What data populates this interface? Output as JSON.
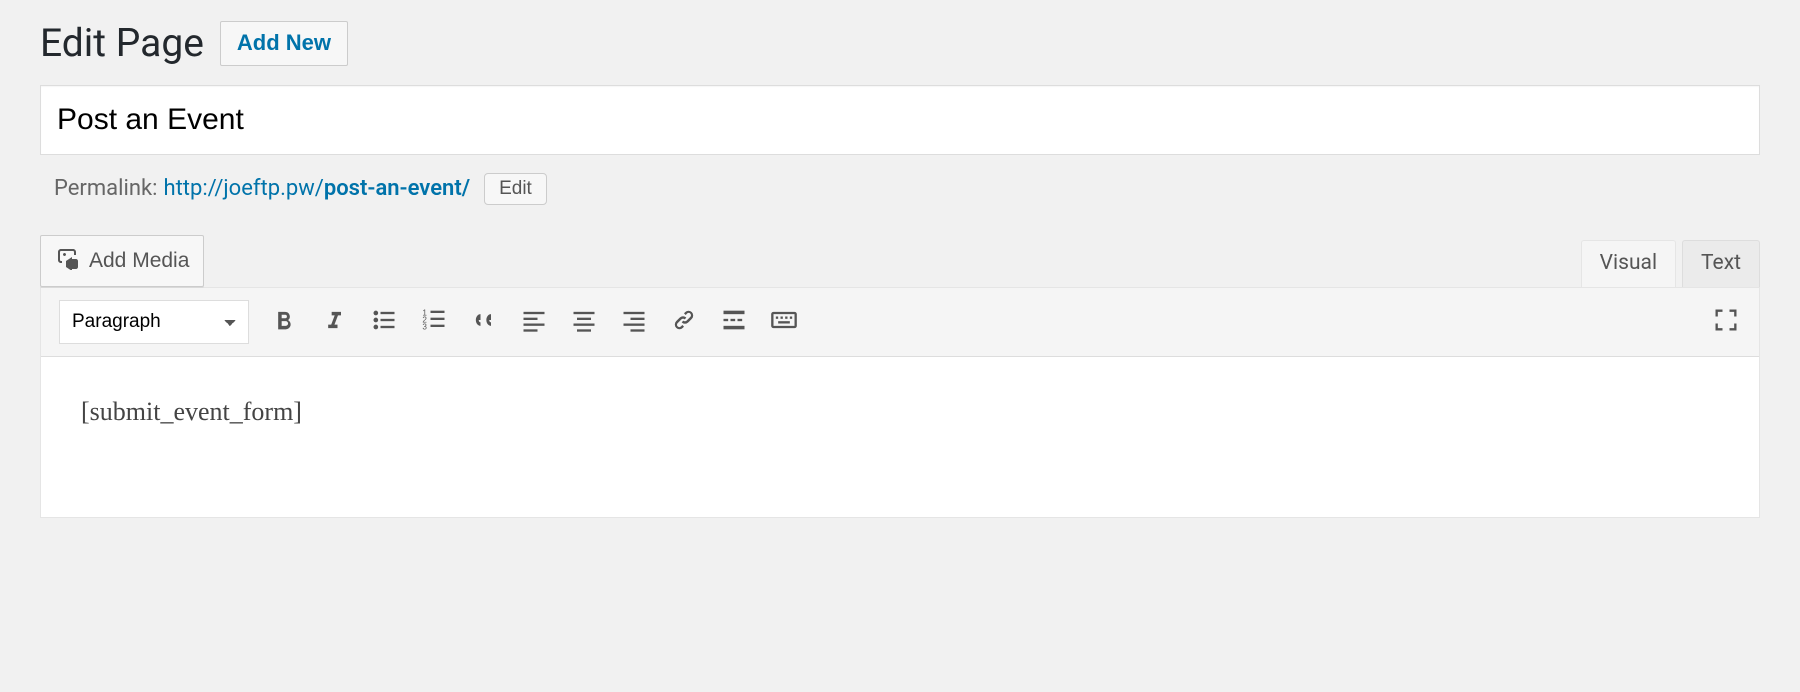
{
  "heading": "Edit Page",
  "add_new_label": "Add New",
  "title_value": "Post an Event",
  "permalink": {
    "label": "Permalink: ",
    "base": "http://joeftp.pw/",
    "slug": "post-an-event/",
    "edit_label": "Edit"
  },
  "add_media_label": "Add Media",
  "tabs": {
    "visual": "Visual",
    "text": "Text"
  },
  "format_selected": "Paragraph",
  "content": "[submit_event_form]"
}
